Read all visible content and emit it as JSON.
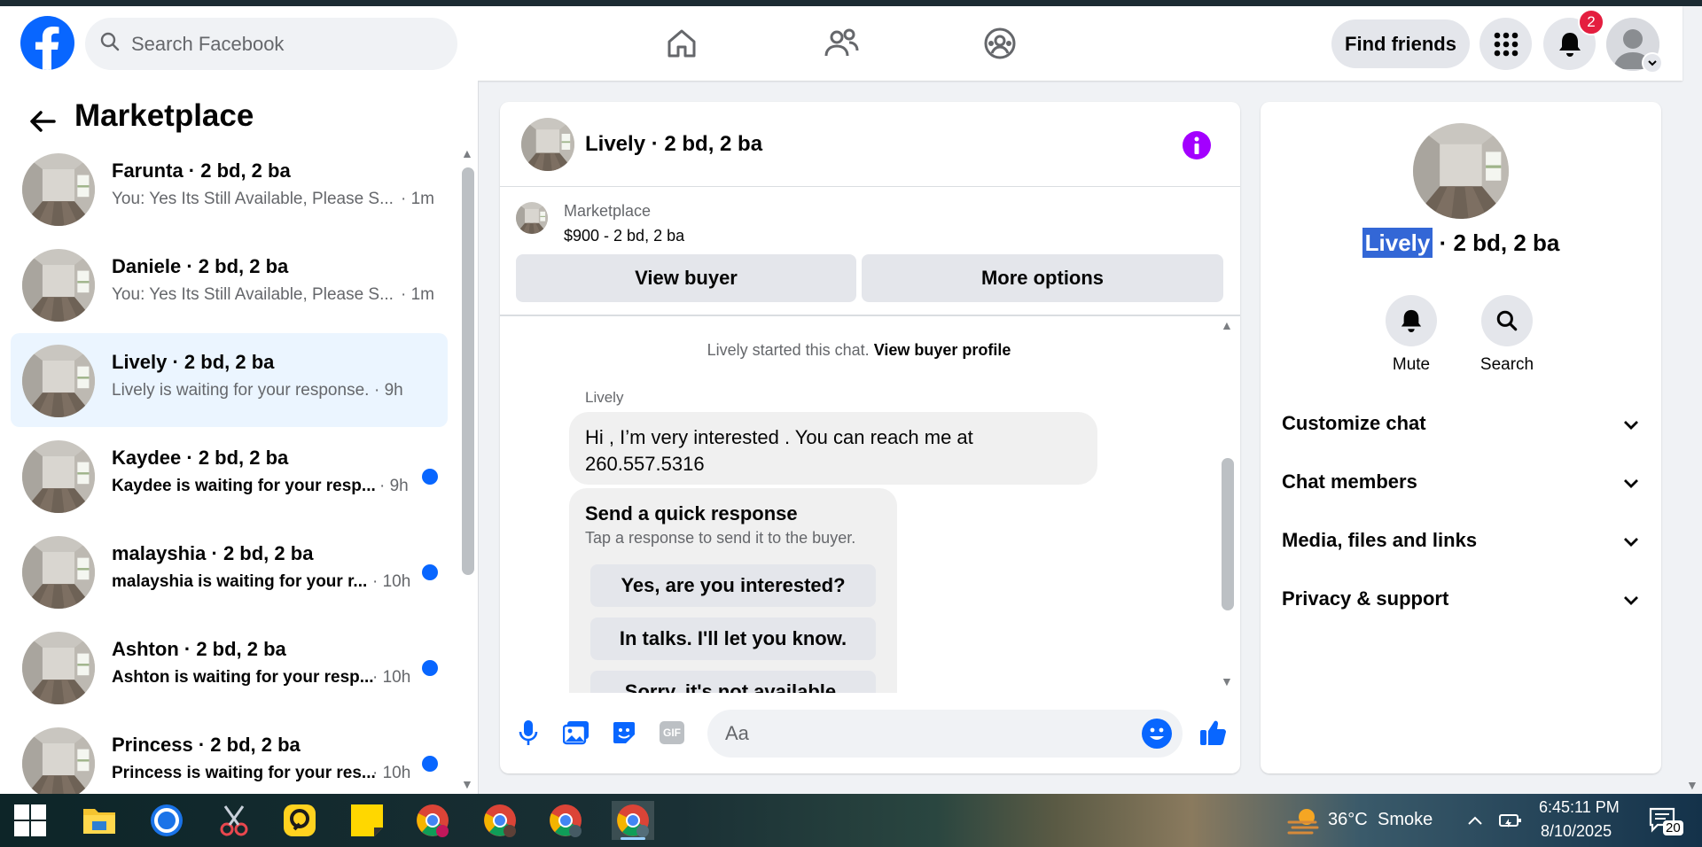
{
  "colors": {
    "brand_blue": "#0866ff",
    "badge_red": "#e41e3f",
    "info_purple": "#a300ff",
    "active_row": "#ebf5ff"
  },
  "topnav": {
    "search_placeholder": "Search Facebook",
    "find_friends_label": "Find friends",
    "notification_count": "2",
    "icons": [
      "facebook-logo",
      "home-icon",
      "friends-icon",
      "groups-icon",
      "menu-grid-icon",
      "bell-icon",
      "profile-avatar"
    ]
  },
  "sidebar": {
    "title": "Marketplace",
    "conversations": [
      {
        "name": "Farunta · 2 bd, 2 ba",
        "preview": "You: Yes Its Still Available, Please S...",
        "time": "· 1m",
        "unread": false
      },
      {
        "name": "Daniele · 2 bd, 2 ba",
        "preview": "You: Yes Its Still Available, Please S...",
        "time": "· 1m",
        "unread": false
      },
      {
        "name": "Lively · 2 bd, 2 ba",
        "preview": "Lively is waiting for your response.",
        "time": "· 9h",
        "unread": false
      },
      {
        "name": "Kaydee · 2 bd, 2 ba",
        "preview": "Kaydee is waiting for your resp...",
        "time": "· 9h",
        "unread": true
      },
      {
        "name": "malayshia · 2 bd, 2 ba",
        "preview": "malayshia is waiting for your r...",
        "time": "· 10h",
        "unread": true
      },
      {
        "name": "Ashton · 2 bd, 2 ba",
        "preview": "Ashton is waiting for your resp...",
        "time": "· 10h",
        "unread": true
      },
      {
        "name": "Princess · 2 bd, 2 ba",
        "preview": "Princess is waiting for your res...",
        "time": "· 10h",
        "unread": true
      }
    ]
  },
  "chat": {
    "title": "Lively · 2 bd, 2 ba",
    "listing_source": "Marketplace",
    "listing_price": "$900 - 2 bd, 2 ba",
    "view_buyer_label": "View buyer",
    "more_options_label": "More options",
    "system_note": "Lively started this chat.",
    "system_note_link": "View buyer profile",
    "sender_name": "Lively",
    "message_line1": "Hi , I’m very interested . You can reach me at",
    "message_line2": "260.557.5316",
    "quick_title": "Send a quick response",
    "quick_subtitle": "Tap a response to send it to the buyer.",
    "quick_responses": [
      "Yes, are you interested?",
      "In talks. I'll let you know.",
      "Sorry, it's not available."
    ],
    "composer_placeholder": "Aa",
    "gif_label": "GIF"
  },
  "details": {
    "title_highlight": "Lively",
    "title_rest": " · 2 bd, 2 ba",
    "mute_label": "Mute",
    "search_label": "Search",
    "sections": [
      "Customize chat",
      "Chat members",
      "Media, files and links",
      "Privacy & support"
    ]
  },
  "taskbar": {
    "temperature": "36°C",
    "weather": "Smoke",
    "time": "6:45:11 PM",
    "date": "8/10/2025",
    "notification_count": "20"
  }
}
